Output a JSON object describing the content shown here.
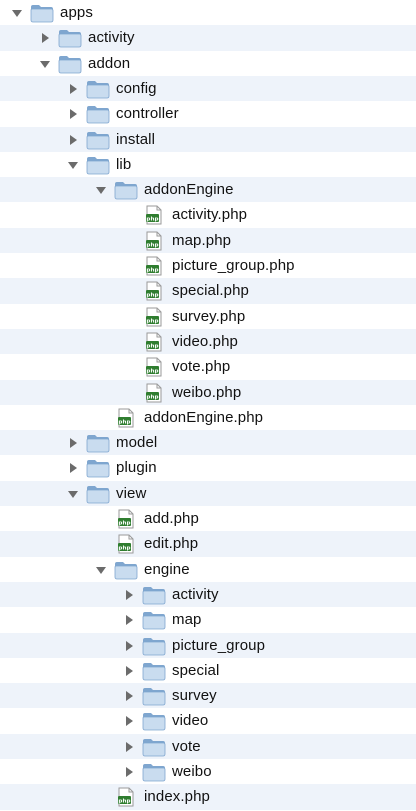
{
  "colors": {
    "folder_light": "#c9dcef",
    "folder_dark": "#7fa6cf",
    "triangle": "#6b6b6b",
    "row_alt": "#eef3fa"
  },
  "rows": [
    {
      "label": "apps",
      "depth": 0,
      "kind": "folder",
      "state": "expanded"
    },
    {
      "label": "activity",
      "depth": 1,
      "kind": "folder",
      "state": "collapsed"
    },
    {
      "label": "addon",
      "depth": 1,
      "kind": "folder",
      "state": "expanded"
    },
    {
      "label": "config",
      "depth": 2,
      "kind": "folder",
      "state": "collapsed"
    },
    {
      "label": "controller",
      "depth": 2,
      "kind": "folder",
      "state": "collapsed"
    },
    {
      "label": "install",
      "depth": 2,
      "kind": "folder",
      "state": "collapsed"
    },
    {
      "label": "lib",
      "depth": 2,
      "kind": "folder",
      "state": "expanded"
    },
    {
      "label": "addonEngine",
      "depth": 3,
      "kind": "folder",
      "state": "expanded"
    },
    {
      "label": "activity.php",
      "depth": 4,
      "kind": "file"
    },
    {
      "label": "map.php",
      "depth": 4,
      "kind": "file"
    },
    {
      "label": "picture_group.php",
      "depth": 4,
      "kind": "file"
    },
    {
      "label": "special.php",
      "depth": 4,
      "kind": "file"
    },
    {
      "label": "survey.php",
      "depth": 4,
      "kind": "file"
    },
    {
      "label": "video.php",
      "depth": 4,
      "kind": "file"
    },
    {
      "label": "vote.php",
      "depth": 4,
      "kind": "file"
    },
    {
      "label": "weibo.php",
      "depth": 4,
      "kind": "file"
    },
    {
      "label": "addonEngine.php",
      "depth": 3,
      "kind": "file"
    },
    {
      "label": "model",
      "depth": 2,
      "kind": "folder",
      "state": "collapsed"
    },
    {
      "label": "plugin",
      "depth": 2,
      "kind": "folder",
      "state": "collapsed"
    },
    {
      "label": "view",
      "depth": 2,
      "kind": "folder",
      "state": "expanded"
    },
    {
      "label": "add.php",
      "depth": 3,
      "kind": "file"
    },
    {
      "label": "edit.php",
      "depth": 3,
      "kind": "file"
    },
    {
      "label": "engine",
      "depth": 3,
      "kind": "folder",
      "state": "expanded"
    },
    {
      "label": "activity",
      "depth": 4,
      "kind": "folder",
      "state": "collapsed"
    },
    {
      "label": "map",
      "depth": 4,
      "kind": "folder",
      "state": "collapsed"
    },
    {
      "label": "picture_group",
      "depth": 4,
      "kind": "folder",
      "state": "collapsed"
    },
    {
      "label": "special",
      "depth": 4,
      "kind": "folder",
      "state": "collapsed"
    },
    {
      "label": "survey",
      "depth": 4,
      "kind": "folder",
      "state": "collapsed"
    },
    {
      "label": "video",
      "depth": 4,
      "kind": "folder",
      "state": "collapsed"
    },
    {
      "label": "vote",
      "depth": 4,
      "kind": "folder",
      "state": "collapsed"
    },
    {
      "label": "weibo",
      "depth": 4,
      "kind": "folder",
      "state": "collapsed"
    },
    {
      "label": "index.php",
      "depth": 3,
      "kind": "file"
    }
  ]
}
